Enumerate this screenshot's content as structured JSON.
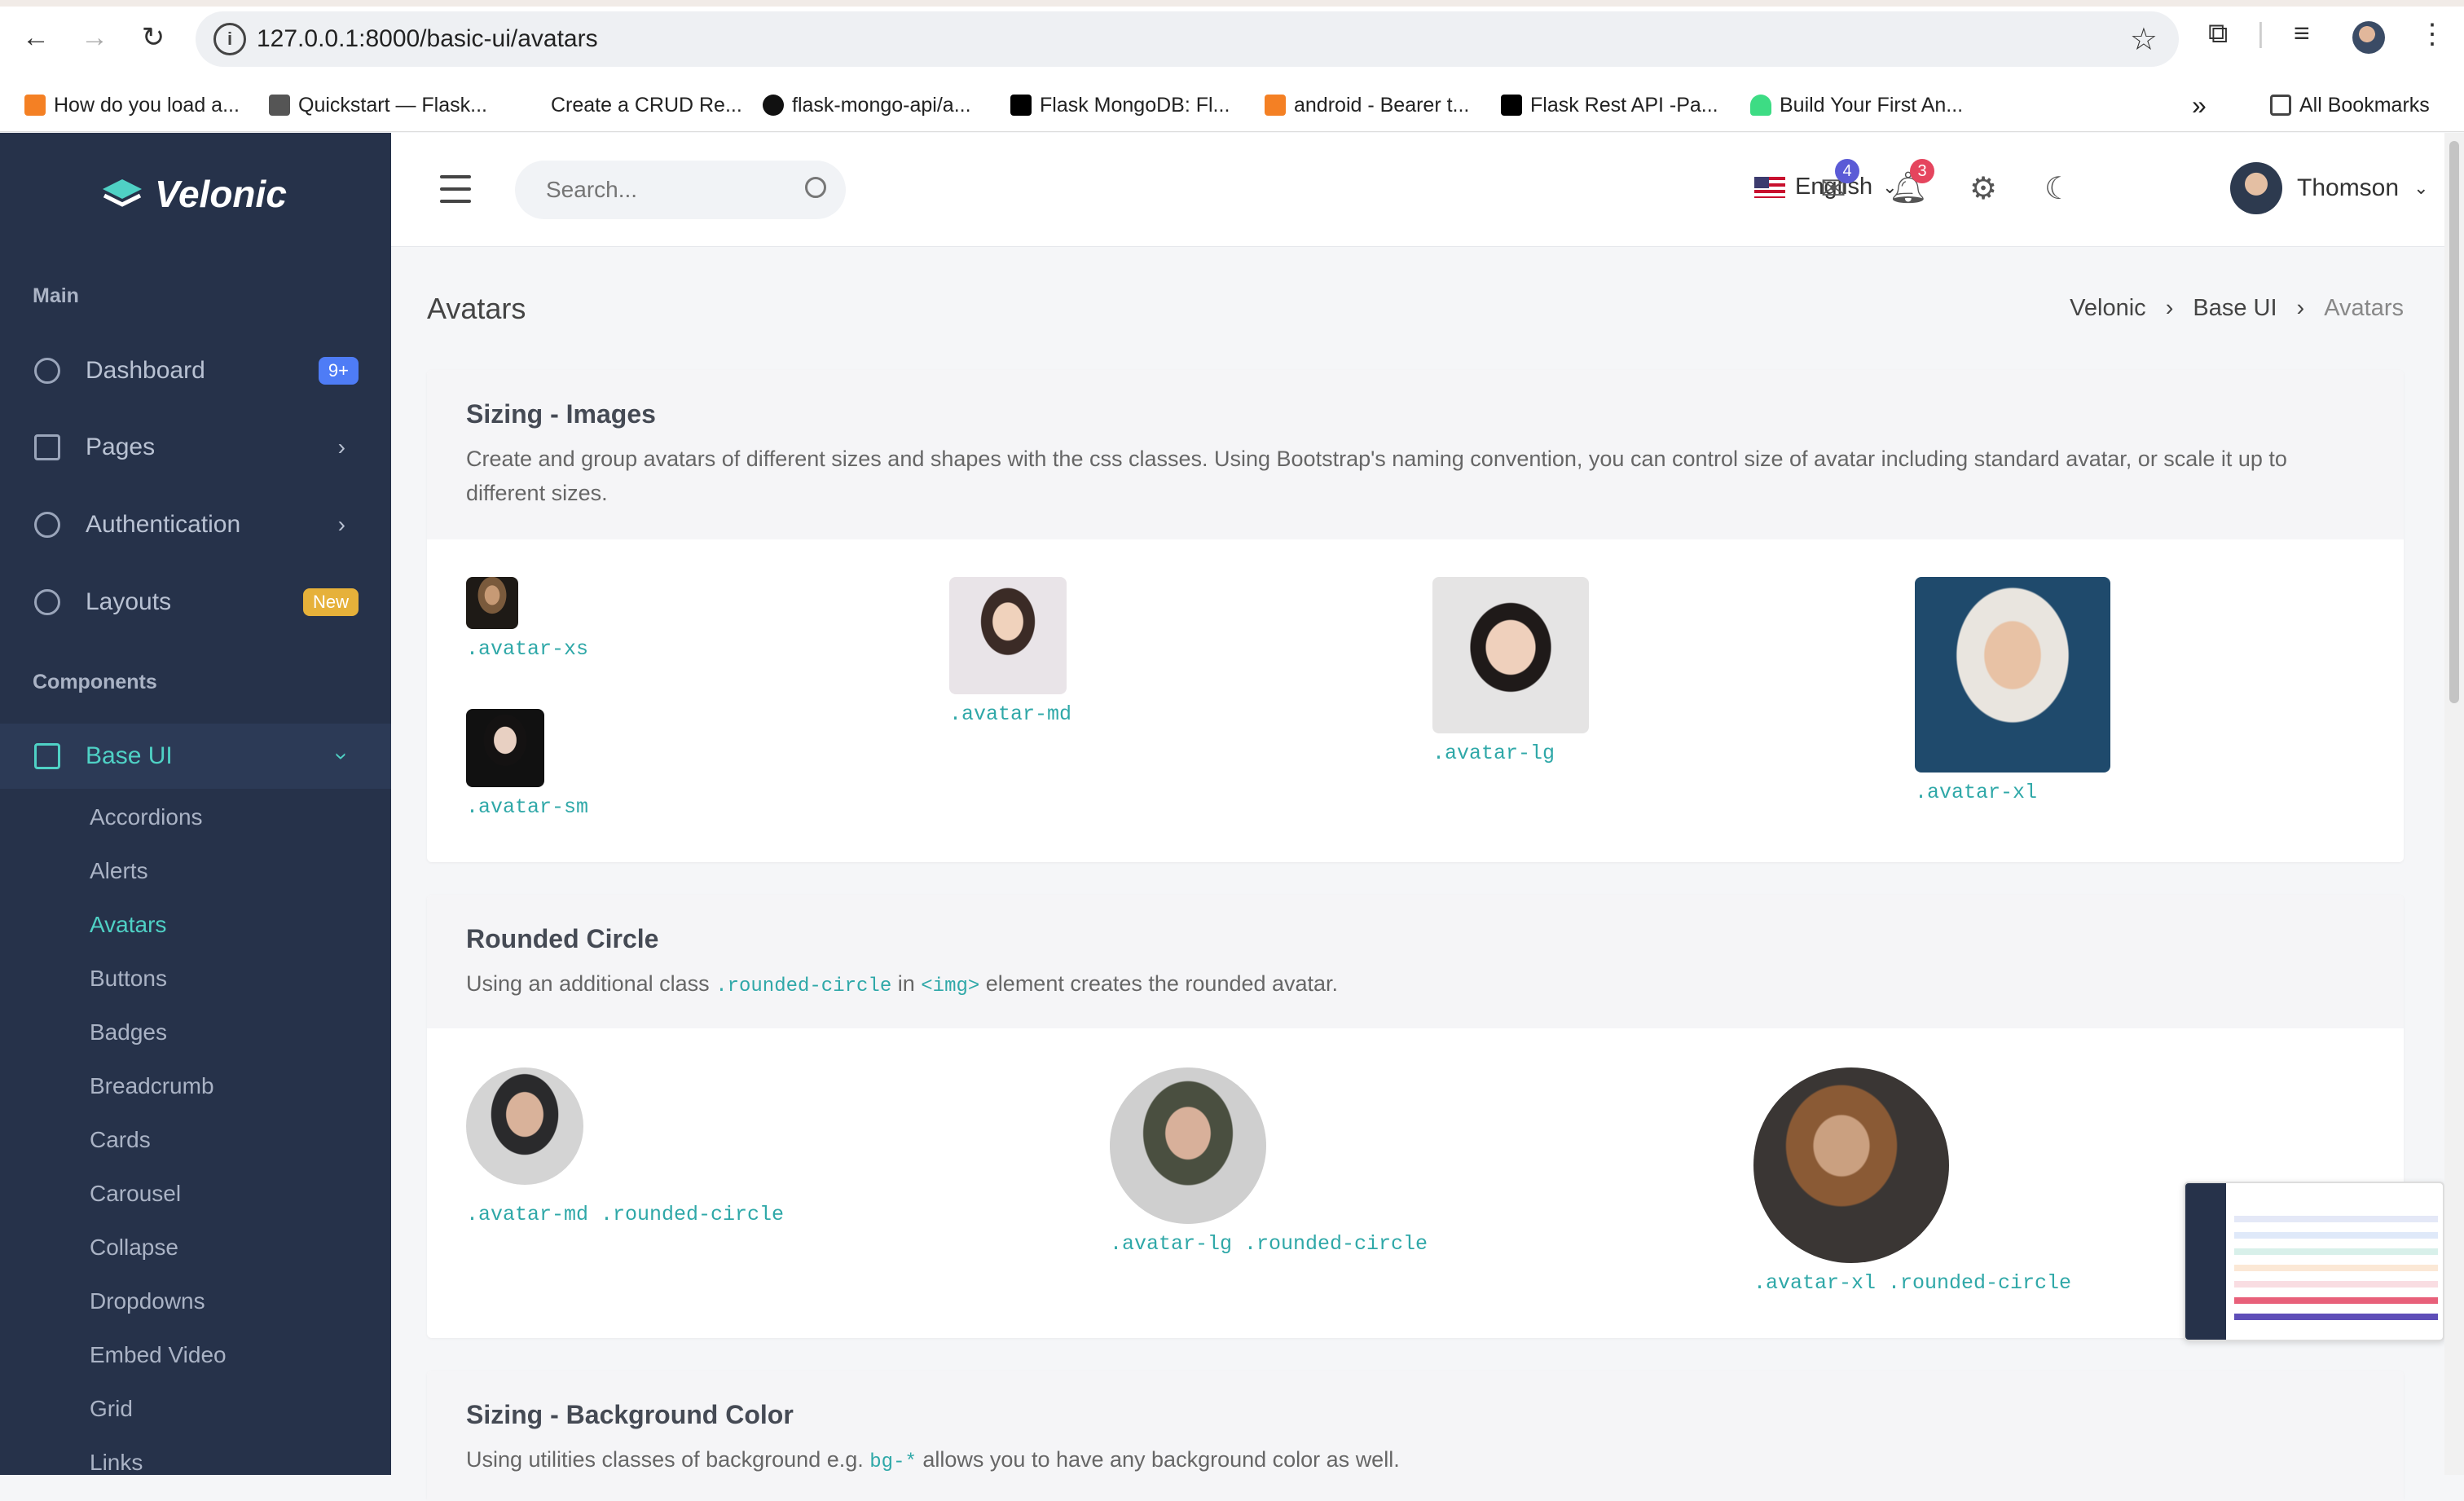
{
  "browser": {
    "url": "127.0.0.1:8000/basic-ui/avatars",
    "bookmarks": [
      "How do you load a...",
      "Quickstart — Flask...",
      "Create a CRUD Re...",
      "flask-mongo-api/a...",
      "Flask MongoDB: Fl...",
      "android - Bearer t...",
      "Flask Rest API -Pa...",
      "Build Your First An..."
    ],
    "more_label": "»",
    "all_bookmarks": "All Bookmarks"
  },
  "sidebar": {
    "brand": "Velonic",
    "section_main": "Main",
    "section_components": "Components",
    "items": [
      {
        "label": "Dashboard",
        "badge": "9+"
      },
      {
        "label": "Pages"
      },
      {
        "label": "Authentication"
      },
      {
        "label": "Layouts",
        "badge": "New"
      },
      {
        "label": "Base UI"
      }
    ],
    "subitems": [
      "Accordions",
      "Alerts",
      "Avatars",
      "Buttons",
      "Badges",
      "Breadcrumb",
      "Cards",
      "Carousel",
      "Collapse",
      "Dropdowns",
      "Embed Video",
      "Grid",
      "Links"
    ]
  },
  "topbar": {
    "search_placeholder": "Search...",
    "language": "English",
    "mail_count": "4",
    "notif_count": "3",
    "user_name": "Thomson"
  },
  "page": {
    "title": "Avatars",
    "breadcrumb": [
      "Velonic",
      "Base UI",
      "Avatars"
    ]
  },
  "card1": {
    "title": "Sizing - Images",
    "desc": "Create and group avatars of different sizes and shapes with the css classes. Using Bootstrap's naming convention, you can control size of avatar including standard avatar, or scale it up to different sizes.",
    "captions": [
      ".avatar-xs",
      ".avatar-sm",
      ".avatar-md",
      ".avatar-lg",
      ".avatar-xl"
    ]
  },
  "card2": {
    "title": "Rounded Circle",
    "desc_pre": "Using an additional class ",
    "desc_code1": ".rounded-circle",
    "desc_mid": " in ",
    "desc_code2": "<img>",
    "desc_post": " element creates the rounded avatar.",
    "captions": [
      ".avatar-md .rounded-circle",
      ".avatar-lg .rounded-circle",
      ".avatar-xl .rounded-circle"
    ]
  },
  "card3": {
    "title": "Sizing - Background Color",
    "desc_pre": "Using utilities classes of background e.g. ",
    "desc_code": "bg-*",
    "desc_post": " allows you to have any background color as well."
  },
  "colors": {
    "sidebar_bg": "#26324a",
    "accent": "#4fd1c5",
    "badge_blue": "#4e7cf6",
    "badge_yellow": "#e6b13a",
    "mail_badge": "#5b5bd6",
    "notif_badge": "#e5455e"
  }
}
